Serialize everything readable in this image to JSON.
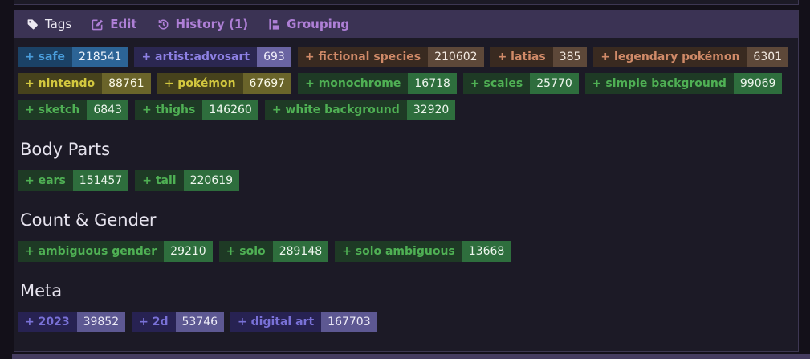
{
  "colors": {
    "page_bg": "#131019",
    "panel_bg": "#1c1a26",
    "panel_border": "#3d3753",
    "toolbar_bg": "#3b3354",
    "toolbar_link": "#ae7fd6",
    "toolbar_text": "#ece9f2",
    "heading_text": "#e6e3ee"
  },
  "toolbar": {
    "tags_label": "Tags",
    "edit_label": "Edit",
    "history_label": "History (1)",
    "grouping_label": "Grouping",
    "icons": {
      "tags": "tag-icon",
      "edit": "pencil-square-icon",
      "history": "clock-rotate-left-icon",
      "grouping": "list-tree-icon"
    }
  },
  "categories": {
    "rating": {
      "text": "#4a9ddb",
      "bg": "#1b4266",
      "badge_bg": "#2c6496",
      "badge_text": "#eef4fb"
    },
    "artist": {
      "text": "#8d80e4",
      "bg": "#2b2751",
      "badge_bg": "#6a64a2",
      "badge_text": "#f0eefa"
    },
    "species": {
      "text": "#d08a68",
      "bg": "#392a20",
      "badge_bg": "#5d4839",
      "badge_text": "#f5ece4"
    },
    "copyright": {
      "text": "#d3c83f",
      "bg": "#46421c",
      "badge_bg": "#6a642a",
      "badge_text": "#fbfae8"
    },
    "general": {
      "text": "#4fb054",
      "bg": "#1e3a25",
      "badge_bg": "#2e6e3d",
      "badge_text": "#eef6ee"
    },
    "meta": {
      "text": "#7971d7",
      "bg": "#272252",
      "badge_bg": "#5d5892",
      "badge_text": "#eceaf6"
    }
  },
  "sections": [
    {
      "heading": null,
      "tags": [
        {
          "name": "safe",
          "count": "218541",
          "category": "rating"
        },
        {
          "name": "artist:advosart",
          "count": "693",
          "category": "artist"
        },
        {
          "name": "fictional species",
          "count": "210602",
          "category": "species"
        },
        {
          "name": "latias",
          "count": "385",
          "category": "species"
        },
        {
          "name": "legendary pokémon",
          "count": "6301",
          "category": "species"
        },
        {
          "name": "nintendo",
          "count": "88761",
          "category": "copyright"
        },
        {
          "name": "pokémon",
          "count": "67697",
          "category": "copyright"
        },
        {
          "name": "monochrome",
          "count": "16718",
          "category": "general"
        },
        {
          "name": "scales",
          "count": "25770",
          "category": "general"
        },
        {
          "name": "simple background",
          "count": "99069",
          "category": "general"
        },
        {
          "name": "sketch",
          "count": "6843",
          "category": "general"
        },
        {
          "name": "thighs",
          "count": "146260",
          "category": "general"
        },
        {
          "name": "white background",
          "count": "32920",
          "category": "general"
        }
      ]
    },
    {
      "heading": "Body Parts",
      "tags": [
        {
          "name": "ears",
          "count": "151457",
          "category": "general"
        },
        {
          "name": "tail",
          "count": "220619",
          "category": "general"
        }
      ]
    },
    {
      "heading": "Count & Gender",
      "tags": [
        {
          "name": "ambiguous gender",
          "count": "29210",
          "category": "general"
        },
        {
          "name": "solo",
          "count": "289148",
          "category": "general"
        },
        {
          "name": "solo ambiguous",
          "count": "13668",
          "category": "general"
        }
      ]
    },
    {
      "heading": "Meta",
      "tags": [
        {
          "name": "2023",
          "count": "39852",
          "category": "meta"
        },
        {
          "name": "2d",
          "count": "53746",
          "category": "meta"
        },
        {
          "name": "digital art",
          "count": "167703",
          "category": "meta"
        }
      ]
    }
  ]
}
